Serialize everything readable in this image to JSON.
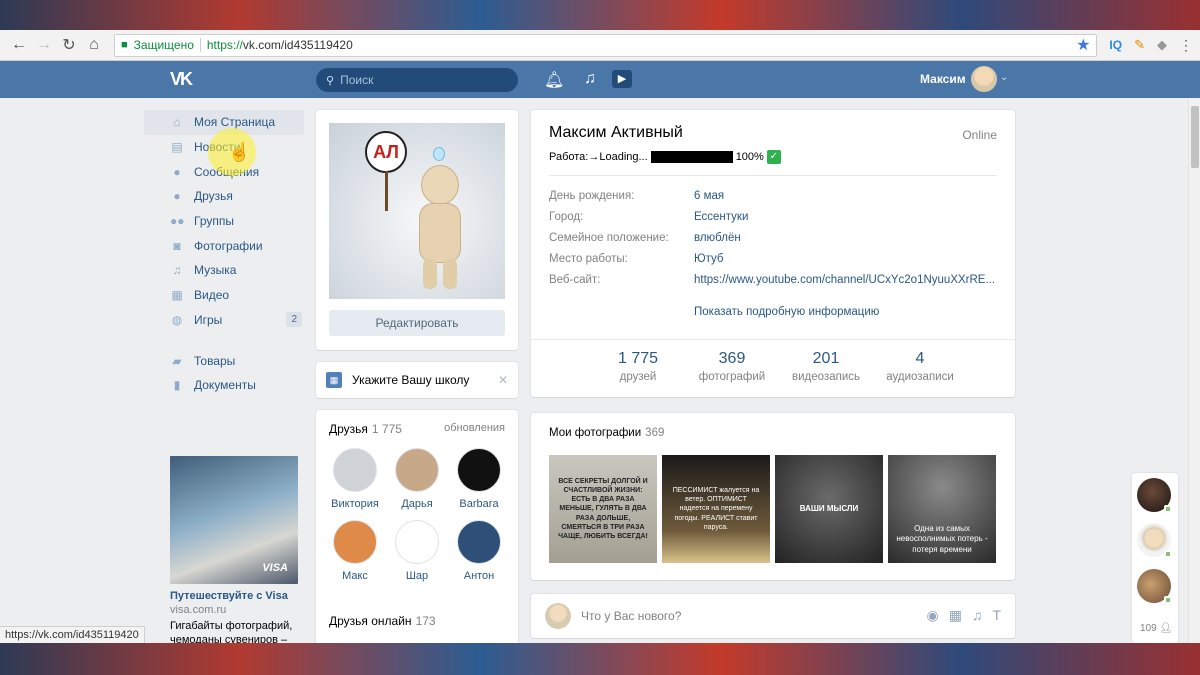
{
  "browser": {
    "secure_label": "Защищено",
    "url_scheme": "https://",
    "url_rest": "vk.com/id435119420",
    "ext_iq": "IQ",
    "status_url": "https://vk.com/id435119420"
  },
  "header": {
    "search_placeholder": "Поиск",
    "user_name": "Максим"
  },
  "sidebar": {
    "items": [
      {
        "label": "Моя Страница",
        "icon": "home-icon"
      },
      {
        "label": "Новости",
        "icon": "news-icon"
      },
      {
        "label": "Сообщения",
        "icon": "messages-icon"
      },
      {
        "label": "Друзья",
        "icon": "friends-icon"
      },
      {
        "label": "Группы",
        "icon": "groups-icon"
      },
      {
        "label": "Фотографии",
        "icon": "photos-icon"
      },
      {
        "label": "Музыка",
        "icon": "music-icon"
      },
      {
        "label": "Видео",
        "icon": "video-icon"
      },
      {
        "label": "Игры",
        "icon": "games-icon",
        "count": "2"
      }
    ],
    "extra": [
      {
        "label": "Товары",
        "icon": "goods-icon"
      },
      {
        "label": "Документы",
        "icon": "docs-icon"
      }
    ]
  },
  "ad": {
    "title": "Путешествуйте с Visa",
    "domain": "visa.com.ru",
    "text": "Гигабайты фотографий, чемоданы сувениров – сохранить семейные",
    "brand": "VISA"
  },
  "avatar_card": {
    "edit_label": "Редактировать",
    "sign_text": "АЛ"
  },
  "school": {
    "label": "Укажите Вашу школу"
  },
  "friends": {
    "title": "Друзья",
    "count": "1 775",
    "updates": "обновления",
    "list": [
      {
        "name": "Виктория",
        "color": "#cfd3d8"
      },
      {
        "name": "Дарья",
        "color": "#c7a98a"
      },
      {
        "name": "Barbara",
        "color": "#111111"
      },
      {
        "name": "Макс",
        "color": "#e08a4a"
      },
      {
        "name": "Шар",
        "color": "#ffffff"
      },
      {
        "name": "Антон",
        "color": "#2d4f78"
      }
    ],
    "online_title": "Друзья онлайн",
    "online_count": "173"
  },
  "profile": {
    "name": "Максим Активный",
    "online": "Online",
    "status_prefix": "Работа:→Loading...",
    "status_suffix": "100%",
    "rows": [
      {
        "key": "День рождения:",
        "value": "6 мая"
      },
      {
        "key": "Город:",
        "value": "Ессентуки"
      },
      {
        "key": "Семейное положение:",
        "value": "влюблён"
      },
      {
        "key": "Место работы:",
        "value": "Ютуб"
      },
      {
        "key": "Веб-сайт:",
        "value": "https://www.youtube.com/channel/UCxYc2o1NyuuXXrRE..."
      }
    ],
    "more": "Показать подробную информацию",
    "counters": [
      {
        "n": "1 775",
        "l": "друзей"
      },
      {
        "n": "369",
        "l": "фотографий"
      },
      {
        "n": "201",
        "l": "видеозапись"
      },
      {
        "n": "4",
        "l": "аудиозаписи"
      }
    ]
  },
  "photos": {
    "title": "Мои фотографии",
    "count": "369",
    "items": [
      {
        "text": "ВСЕ СЕКРЕТЫ ДОЛГОЙ И СЧАСТЛИВОЙ ЖИЗНИ: ЕСТЬ В ДВА РАЗА МЕНЬШЕ, ГУЛЯТЬ В ДВА РАЗА ДОЛЬШЕ, СМЕЯТЬСЯ В ТРИ РАЗА ЧАЩЕ, ЛЮБИТЬ ВСЕГДА!"
      },
      {
        "text": "ПЕССИМИСТ жалуется на ветер. ОПТИМИСТ надеется на перемену погоды. РЕАЛИСТ ставит парусa."
      },
      {
        "text": "ВАШИ МЫСЛИ"
      },
      {
        "text": "Одна из самых невосполнимых потерь - потеря времени"
      }
    ]
  },
  "post": {
    "placeholder": "Что у Вас нового?"
  },
  "fast_chat": {
    "count": "109"
  }
}
